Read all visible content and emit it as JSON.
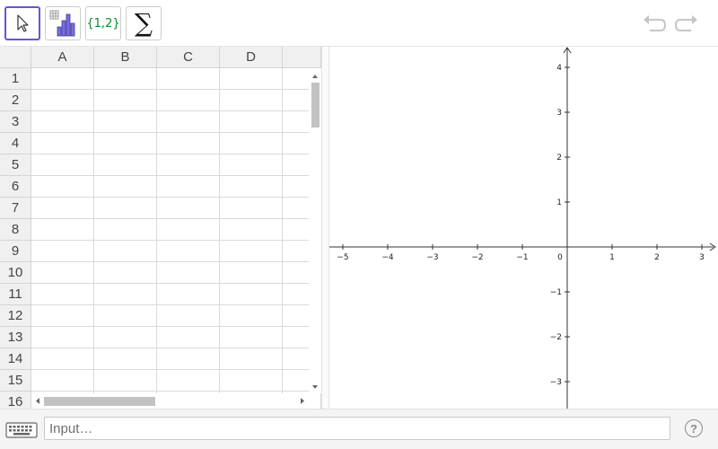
{
  "toolbar": {
    "tools": [
      {
        "name": "move-tool",
        "icon": "cursor-arrow-icon",
        "selected": true
      },
      {
        "name": "chart-tool",
        "icon": "bar-chart-icon",
        "selected": false
      },
      {
        "name": "list-tool",
        "icon": "list-braces-icon",
        "label": "{1,2}",
        "selected": false
      },
      {
        "name": "sum-tool",
        "icon": "sigma-icon",
        "label": "∑",
        "selected": false
      }
    ],
    "undo_icon": "undo-icon",
    "redo_icon": "redo-icon"
  },
  "spreadsheet": {
    "columns": [
      "A",
      "B",
      "C",
      "D"
    ],
    "rows": [
      "1",
      "2",
      "3",
      "4",
      "5",
      "6",
      "7",
      "8",
      "9",
      "10",
      "11",
      "12",
      "13",
      "14",
      "15",
      "16"
    ]
  },
  "graphics": {
    "x_ticks": [
      "−5",
      "−4",
      "−3",
      "−2",
      "−1",
      "0",
      "1",
      "2",
      "3"
    ],
    "y_ticks_pos": [
      "4",
      "3",
      "2",
      "1"
    ],
    "y_ticks_neg": [
      "−1",
      "−2",
      "−3"
    ],
    "x_values": [
      -5,
      -4,
      -3,
      -2,
      -1,
      0,
      1,
      2,
      3
    ],
    "y_values_pos": [
      4,
      3,
      2,
      1
    ],
    "y_values_neg": [
      -1,
      -2,
      -3
    ]
  },
  "input_bar": {
    "placeholder": "Input…",
    "help_label": "?",
    "keyboard_icon": "keyboard-icon"
  },
  "colors": {
    "accent": "#6557d2",
    "list_green": "#0a8a2b",
    "chart_purple": "#6b5fd6"
  }
}
